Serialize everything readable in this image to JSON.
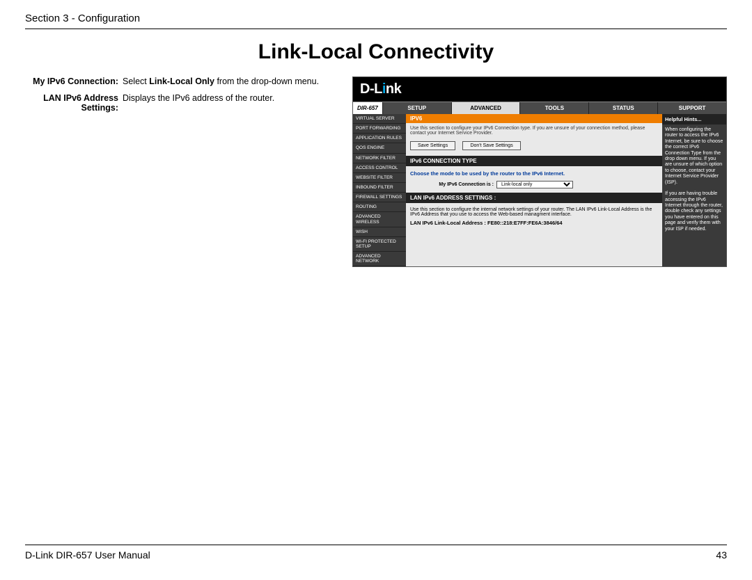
{
  "header": {
    "section": "Section 3 - Configuration"
  },
  "title": "Link-Local Connectivity",
  "definitions": [
    {
      "label": "My IPv6 Connection:",
      "text_pre": "Select ",
      "bold": "Link-Local Only",
      "text_post": " from the drop-down menu."
    },
    {
      "label": "LAN IPv6 Address Settings:",
      "text_pre": "Displays the IPv6 address of the router.",
      "bold": "",
      "text_post": ""
    }
  ],
  "router": {
    "brand": "D-Link",
    "model": "DIR-657",
    "tabs": [
      "SETUP",
      "ADVANCED",
      "TOOLS",
      "STATUS",
      "SUPPORT"
    ],
    "active_tab": 1,
    "sidenav": [
      "VIRTUAL SERVER",
      "PORT FORWARDING",
      "APPLICATION RULES",
      "QOS ENGINE",
      "NETWORK FILTER",
      "ACCESS CONTROL",
      "WEBSITE FILTER",
      "INBOUND FILTER",
      "FIREWALL SETTINGS",
      "ROUTING",
      "ADVANCED WIRELESS",
      "WISH",
      "WI-FI PROTECTED SETUP",
      "ADVANCED NETWORK"
    ],
    "crumb": "IPV6",
    "instruction": "Use this section to configure your IPv6 Connection type. If you are unsure of your connection method, please contact your Internet Service Provider.",
    "buttons": {
      "save": "Save Settings",
      "dont": "Don't Save Settings"
    },
    "sec1": {
      "header": "IPv6 CONNECTION TYPE",
      "mode_text": "Choose the mode to be used by the router to the IPv6 Internet.",
      "field_label": "My IPv6 Connection is :",
      "field_value": "Link-local only"
    },
    "sec2": {
      "header": "LAN IPv6 ADDRESS SETTINGS :",
      "note": "Use this section to configure the internal network settings of your router. The LAN IPv6 Link-Local Address is the IPv6 Address that you use to access the Web-based managment interface.",
      "addr_label": "LAN IPv6 Link-Local Address : ",
      "addr_value": "FE80::218:E7FF:FE6A:3846/64"
    },
    "hints": {
      "header": "Helpful Hints...",
      "p1": "When configuring the router to access the IPv6 Internet, be sure to choose the correct IPv6 Connection Type from the drop down menu. If you are unsure of which option to choose, contact your Internet Service Provider (ISP).",
      "p2": "If you are having trouble accessing the IPv6 Internet through the router, double check any settings you have entered on this page and verify them with your ISP if needed."
    }
  },
  "footer": {
    "manual": "D-Link DIR-657 User Manual",
    "page": "43"
  }
}
